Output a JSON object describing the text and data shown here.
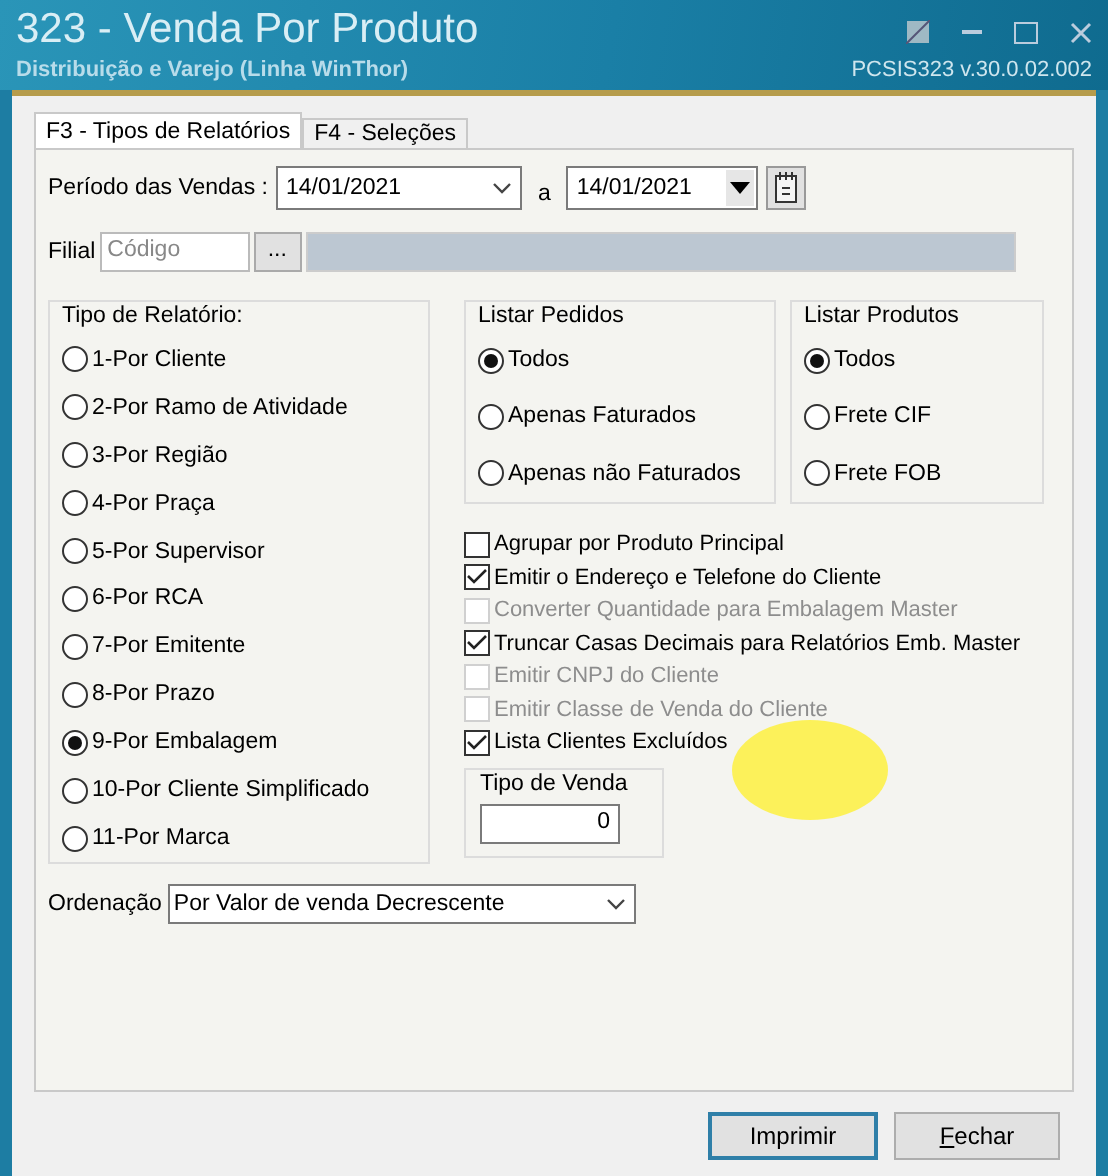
{
  "window": {
    "title": "323 - Venda Por Produto",
    "subtitle": "Distribuição e Varejo (Linha WinThor)",
    "version": "PCSIS323  v.30.0.02.002"
  },
  "tabs": [
    {
      "label": "F3 - Tipos de Relatórios",
      "selected": true
    },
    {
      "label": "F4 - Seleções",
      "selected": false
    }
  ],
  "period": {
    "label": "Período das Vendas :",
    "from": "14/01/2021",
    "separator": "a",
    "to": "14/01/2021"
  },
  "filial": {
    "label": "Filial",
    "placeholder": "Código",
    "button": "..."
  },
  "report_type": {
    "title": "Tipo de Relatório:",
    "options": [
      {
        "label": "1-Por Cliente",
        "selected": false
      },
      {
        "label": "2-Por Ramo de Atividade",
        "selected": false
      },
      {
        "label": "3-Por Região",
        "selected": false
      },
      {
        "label": "4-Por Praça",
        "selected": false
      },
      {
        "label": "5-Por Supervisor",
        "selected": false
      },
      {
        "label": "6-Por RCA",
        "selected": false
      },
      {
        "label": "7-Por Emitente",
        "selected": false
      },
      {
        "label": "8-Por Prazo",
        "selected": false
      },
      {
        "label": "9-Por Embalagem",
        "selected": true
      },
      {
        "label": "10-Por Cliente Simplificado",
        "selected": false
      },
      {
        "label": "11-Por Marca",
        "selected": false
      }
    ]
  },
  "list_orders": {
    "title": "Listar Pedidos",
    "options": [
      {
        "label": "Todos",
        "selected": true
      },
      {
        "label": "Apenas Faturados",
        "selected": false
      },
      {
        "label": "Apenas não Faturados",
        "selected": false
      }
    ]
  },
  "list_products": {
    "title": "Listar Produtos",
    "options": [
      {
        "label": "Todos",
        "selected": true
      },
      {
        "label": "Frete CIF",
        "selected": false
      },
      {
        "label": "Frete FOB",
        "selected": false
      }
    ]
  },
  "checkboxes": [
    {
      "label": "Agrupar por Produto Principal",
      "checked": false,
      "disabled": false
    },
    {
      "label": "Emitir o Endereço e Telefone do Cliente",
      "checked": true,
      "disabled": false
    },
    {
      "label": "Converter Quantidade para Embalagem Master",
      "checked": false,
      "disabled": true
    },
    {
      "label": "Truncar Casas Decimais para Relatórios Emb. Master",
      "checked": true,
      "disabled": false
    },
    {
      "label": "Emitir CNPJ do Cliente",
      "checked": false,
      "disabled": true
    },
    {
      "label": "Emitir Classe de Venda do Cliente",
      "checked": false,
      "disabled": true
    },
    {
      "label": "Lista Clientes Excluídos",
      "checked": true,
      "disabled": false
    }
  ],
  "sale_type": {
    "title": "Tipo de Venda",
    "value": "0"
  },
  "ordering": {
    "label": "Ordenação",
    "value": "Por Valor de venda Decrescente"
  },
  "buttons": [
    {
      "label": "Imprimir",
      "focused": true
    },
    {
      "label": "Fechar",
      "focused": false
    }
  ]
}
